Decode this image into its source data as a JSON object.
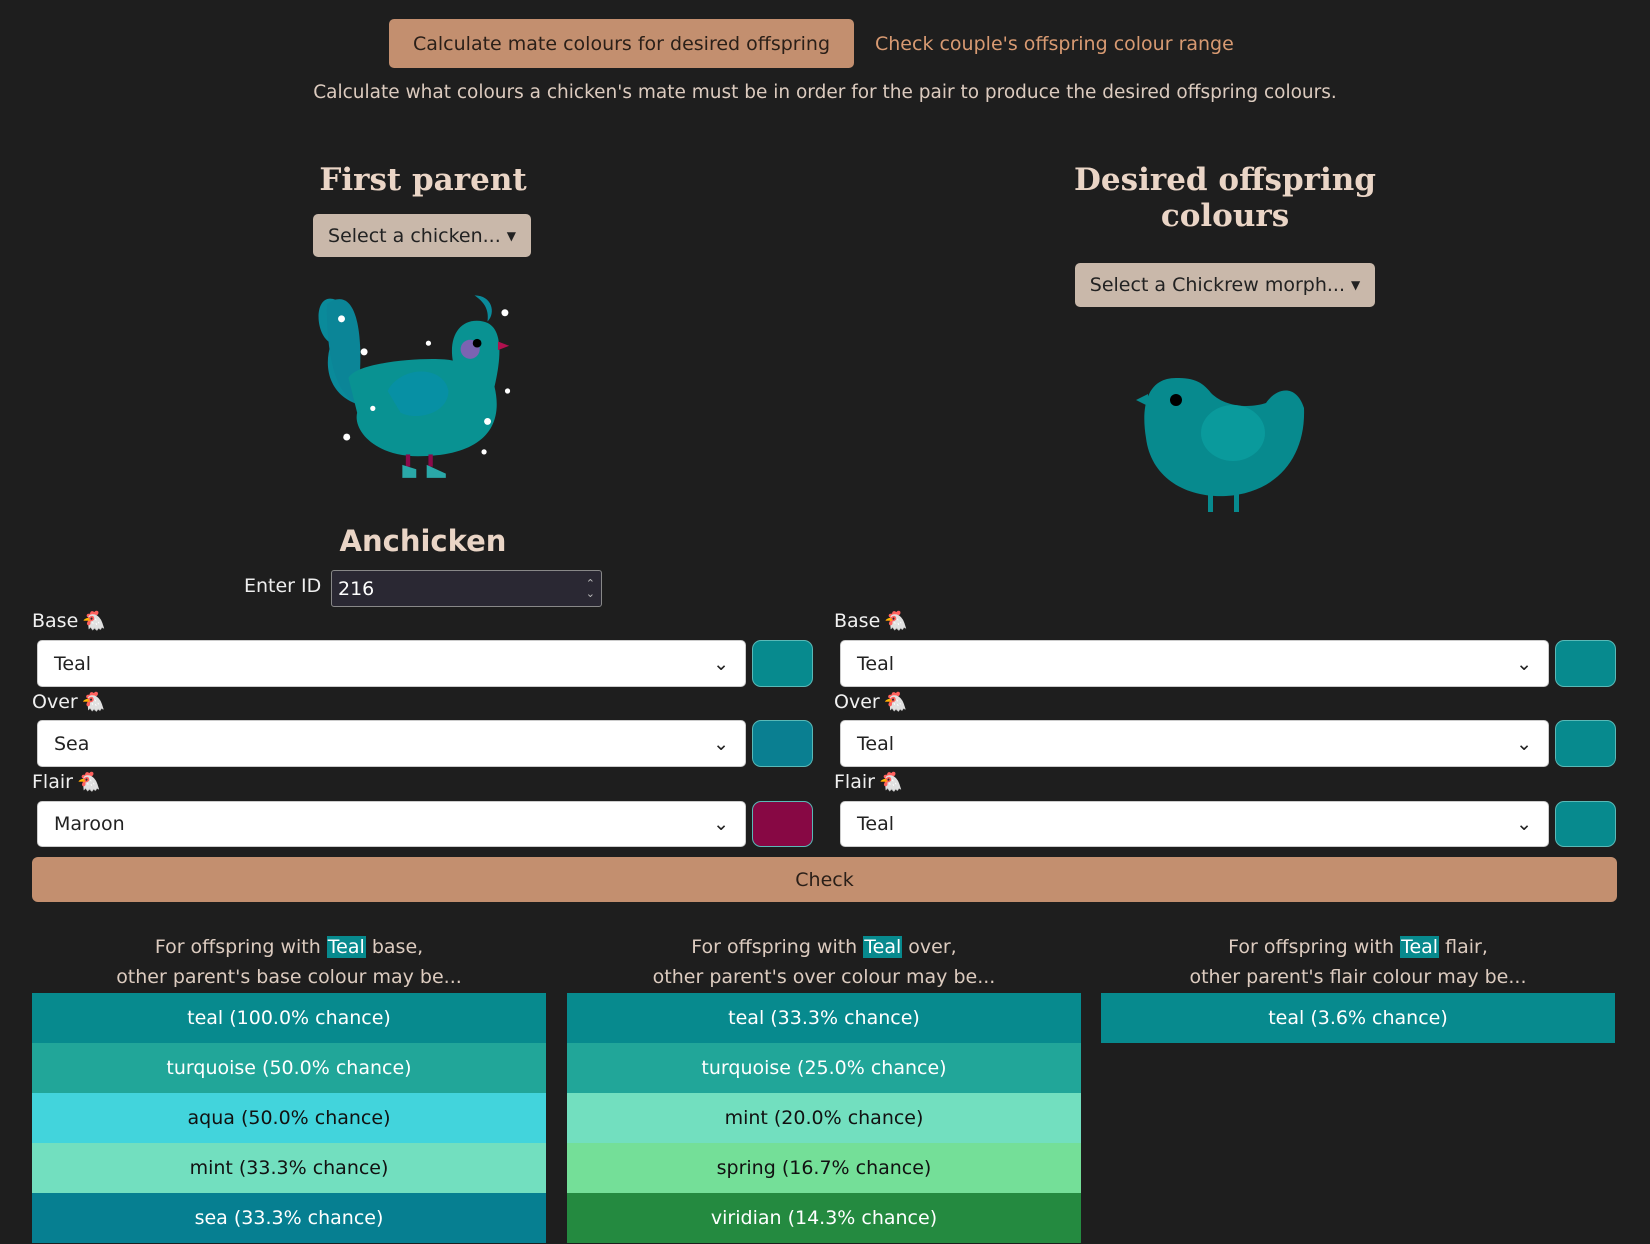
{
  "tabs": {
    "active": "Calculate mate colours for desired offspring",
    "other": "Check couple's offspring colour range"
  },
  "description": "Calculate what colours a chicken's mate must be in order for the pair to produce the desired offspring colours.",
  "first_parent": {
    "heading": "First parent",
    "select_label": "Select a chicken...",
    "name": "Anchicken",
    "id_label": "Enter ID",
    "id_value": "216",
    "fields": [
      {
        "label": "Base",
        "value": "Teal",
        "color": "#078a8e"
      },
      {
        "label": "Over",
        "value": "Sea",
        "color": "#0a7f91"
      },
      {
        "label": "Flair",
        "value": "Maroon",
        "color": "#870844"
      }
    ]
  },
  "offspring": {
    "heading": "Desired offspring colours",
    "select_label": "Select a Chickrew morph...",
    "fields": [
      {
        "label": "Base",
        "value": "Teal",
        "color": "#078a8e"
      },
      {
        "label": "Over",
        "value": "Teal",
        "color": "#078a8e"
      },
      {
        "label": "Flair",
        "value": "Teal",
        "color": "#078a8e"
      }
    ]
  },
  "check_label": "Check",
  "results": [
    {
      "pre": "For offspring with ",
      "hl": "Teal",
      "post": " base,",
      "line2": "other parent's base colour may be...",
      "rows": [
        {
          "text": "teal (100.0% chance)",
          "bg": "#078a8e",
          "fg": "#ffffff"
        },
        {
          "text": "turquoise (50.0% chance)",
          "bg": "#21a699",
          "fg": "#ffffff"
        },
        {
          "text": "aqua (50.0% chance)",
          "bg": "#42d4dc",
          "fg": "#111111"
        },
        {
          "text": "mint (33.3% chance)",
          "bg": "#72dfbf",
          "fg": "#111111"
        },
        {
          "text": "sea (33.3% chance)",
          "bg": "#067f91",
          "fg": "#ffffff"
        }
      ]
    },
    {
      "pre": "For offspring with ",
      "hl": "Teal",
      "post": " over,",
      "line2": "other parent's over colour may be...",
      "rows": [
        {
          "text": "teal (33.3% chance)",
          "bg": "#078a8e",
          "fg": "#ffffff"
        },
        {
          "text": "turquoise (25.0% chance)",
          "bg": "#21a699",
          "fg": "#ffffff"
        },
        {
          "text": "mint (20.0% chance)",
          "bg": "#72dfbf",
          "fg": "#111111"
        },
        {
          "text": "spring (16.7% chance)",
          "bg": "#74df98",
          "fg": "#111111"
        },
        {
          "text": "viridian (14.3% chance)",
          "bg": "#248a40",
          "fg": "#ffffff"
        }
      ]
    },
    {
      "pre": "For offspring with ",
      "hl": "Teal",
      "post": " flair,",
      "line2": "other parent's flair colour may be...",
      "rows": [
        {
          "text": "teal (3.6% chance)",
          "bg": "#078a8e",
          "fg": "#ffffff"
        }
      ]
    }
  ]
}
